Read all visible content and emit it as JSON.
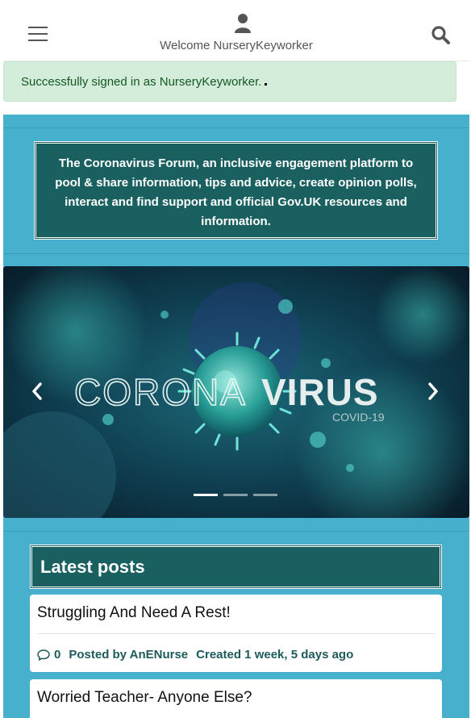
{
  "header": {
    "welcome": "Welcome NurseryKeyworker",
    "icons": {
      "menu": "hamburger-icon",
      "user": "user-icon",
      "search": "search-icon"
    }
  },
  "alert": {
    "message": "Successfully signed in as NurseryKeyworker."
  },
  "intro": {
    "text": "The Coronavirus Forum, an inclusive engagement platform to pool & share information, tips and advice, create opinion polls, interact and find support and official Gov.UK resources and information."
  },
  "carousel": {
    "image_title_part1": "CORONA",
    "image_title_part2": "VIRUS",
    "image_subtitle": "COVID-19",
    "slides": 3,
    "active_slide": 1
  },
  "latest": {
    "heading": "Latest posts",
    "posts": [
      {
        "title": "Struggling And Need A Rest!",
        "comments": "0",
        "posted_by": "Posted by AnENurse",
        "created": "Created 1 week, 5 days ago"
      },
      {
        "title": "Worried Teacher- Anyone Else?"
      }
    ]
  },
  "colors": {
    "page_bg": "#47b1cd",
    "panel": "#1a6061",
    "alert_bg": "#d4edda",
    "alert_text": "#155724",
    "meta_text": "#1e5a5b"
  }
}
